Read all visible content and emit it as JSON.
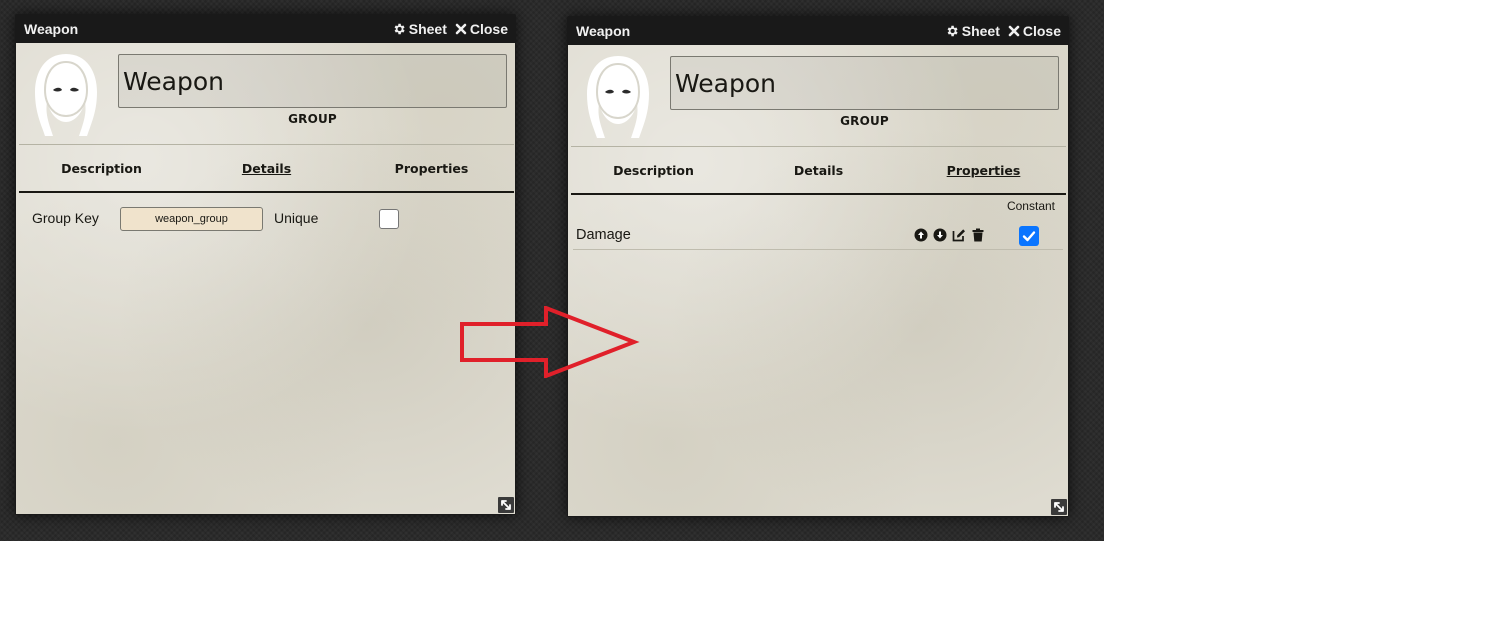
{
  "colors": {
    "desktop_bg": "#2b2b2b",
    "window_frame": "#191919",
    "parchment": "#dedbd0",
    "group_key_bg": "#f0e3cc",
    "checkbox_checked": "#0a75ff",
    "arrow": "#e0202a"
  },
  "left_window": {
    "title": "Weapon",
    "sheet_label": "Sheet",
    "close_label": "Close",
    "name_value": "Weapon",
    "type_label": "GROUP",
    "tabs": [
      {
        "label": "Description",
        "active": false
      },
      {
        "label": "Details",
        "active": true
      },
      {
        "label": "Properties",
        "active": false
      }
    ],
    "details": {
      "group_key_label": "Group Key",
      "group_key_value": "weapon_group",
      "unique_label": "Unique",
      "unique_checked": false
    }
  },
  "right_window": {
    "title": "Weapon",
    "sheet_label": "Sheet",
    "close_label": "Close",
    "name_value": "Weapon",
    "type_label": "GROUP",
    "tabs": [
      {
        "label": "Description",
        "active": false
      },
      {
        "label": "Details",
        "active": false
      },
      {
        "label": "Properties",
        "active": true
      }
    ],
    "properties": {
      "constant_header": "Constant",
      "rows": [
        {
          "name": "Damage",
          "constant": true
        }
      ]
    }
  },
  "icons": {
    "header_sheet": "gear-icon",
    "header_close": "times-icon",
    "row_controls": [
      "arrow-circle-up-icon",
      "arrow-circle-down-icon",
      "edit-icon",
      "trash-icon"
    ],
    "resize": "expand-icon",
    "annotation": "right-arrow-outline"
  }
}
